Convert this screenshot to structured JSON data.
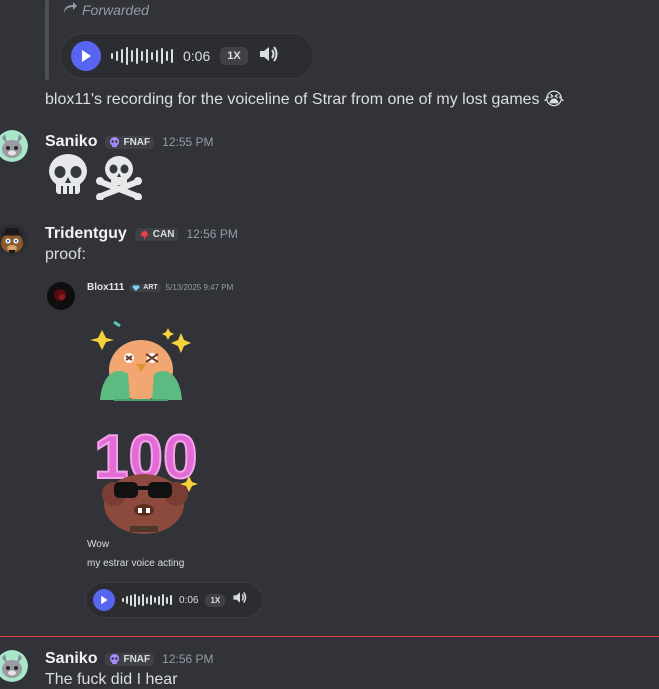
{
  "forwarded": {
    "label": "Forwarded",
    "voice": {
      "duration": "0:06",
      "speed": "1X"
    },
    "caption": "blox11's recording for the voiceline of Strar from one of my lost games",
    "caption_emoji": "😭"
  },
  "messages": [
    {
      "username": "Saniko",
      "tag": "FNAF",
      "time": "12:55 PM"
    },
    {
      "username": "Tridentguy",
      "tag": "CAN",
      "time": "12:56 PM",
      "text": "proof:"
    },
    {
      "username": "Saniko",
      "tag": "FNAF",
      "time": "12:56 PM",
      "text": "The fuck did I hear"
    }
  ],
  "embed": {
    "author": "Blox111",
    "tag": "ART",
    "time": "5/13/2025 9:47 PM",
    "line1": "Wow",
    "line2": "my estrar voice acting",
    "voice": {
      "duration": "0:06",
      "speed": "1X"
    },
    "sticker_text": "100"
  },
  "colors": {
    "accent": "#5865f2",
    "new_divider": "#f23f43"
  }
}
